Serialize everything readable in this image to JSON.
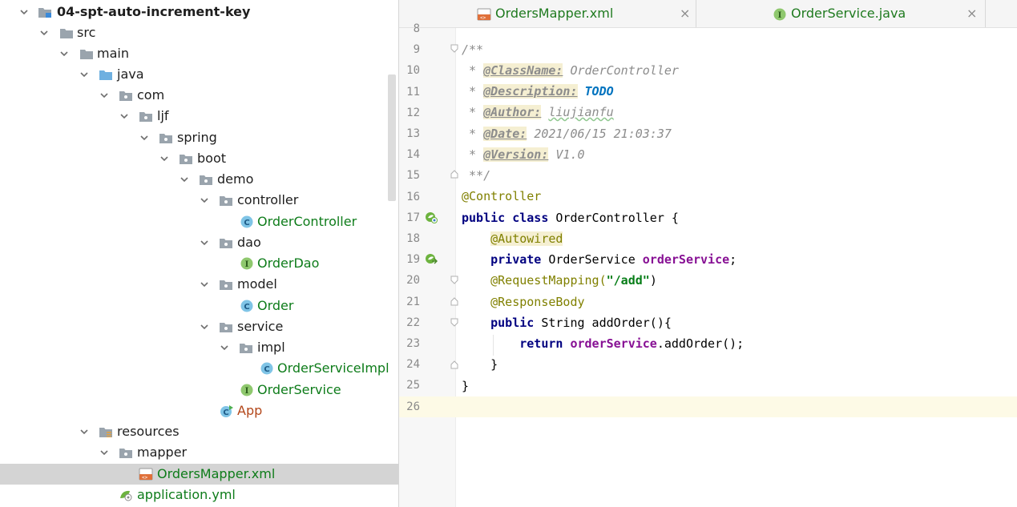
{
  "tree": {
    "items": [
      {
        "label": "04-spt-auto-increment-key",
        "icon": "module-folder-icon",
        "style": "bold"
      },
      {
        "label": "src",
        "icon": "folder-icon",
        "style": "normal"
      },
      {
        "label": "main",
        "icon": "folder-icon",
        "style": "normal"
      },
      {
        "label": "java",
        "icon": "source-root-folder-icon",
        "style": "normal"
      },
      {
        "label": "com",
        "icon": "package-icon",
        "style": "normal"
      },
      {
        "label": "ljf",
        "icon": "package-icon",
        "style": "normal"
      },
      {
        "label": "spring",
        "icon": "package-icon",
        "style": "normal"
      },
      {
        "label": "boot",
        "icon": "package-icon",
        "style": "normal"
      },
      {
        "label": "demo",
        "icon": "package-icon",
        "style": "normal"
      },
      {
        "label": "controller",
        "icon": "package-icon",
        "style": "normal"
      },
      {
        "label": "OrderController",
        "icon": "class-icon",
        "style": "green"
      },
      {
        "label": "dao",
        "icon": "package-icon",
        "style": "normal"
      },
      {
        "label": "OrderDao",
        "icon": "interface-icon",
        "style": "green"
      },
      {
        "label": "model",
        "icon": "package-icon",
        "style": "normal"
      },
      {
        "label": "Order",
        "icon": "class-icon",
        "style": "green"
      },
      {
        "label": "service",
        "icon": "package-icon",
        "style": "normal"
      },
      {
        "label": "impl",
        "icon": "package-icon",
        "style": "normal"
      },
      {
        "label": "OrderServiceImpl",
        "icon": "class-icon",
        "style": "green"
      },
      {
        "label": "OrderService",
        "icon": "interface-icon",
        "style": "green"
      },
      {
        "label": "App",
        "icon": "spring-boot-app-icon",
        "style": "red"
      },
      {
        "label": "resources",
        "icon": "resources-folder-icon",
        "style": "normal"
      },
      {
        "label": "mapper",
        "icon": "package-icon",
        "style": "normal"
      },
      {
        "label": "OrdersMapper.xml",
        "icon": "xml-file-icon",
        "style": "green",
        "selected": true
      },
      {
        "label": "application.yml",
        "icon": "yaml-config-icon",
        "style": "green"
      }
    ]
  },
  "tabs": [
    {
      "label": "OrdersMapper.xml",
      "icon": "xml-file-icon",
      "close": "×"
    },
    {
      "label": "OrderService.java",
      "icon": "interface-icon",
      "close": "×"
    }
  ],
  "editor": {
    "current_line": 26,
    "lines": [
      {
        "n": "8"
      },
      {
        "n": "9"
      },
      {
        "n": "10"
      },
      {
        "n": "11"
      },
      {
        "n": "12"
      },
      {
        "n": "13"
      },
      {
        "n": "14"
      },
      {
        "n": "15"
      },
      {
        "n": "16"
      },
      {
        "n": "17"
      },
      {
        "n": "18"
      },
      {
        "n": "19"
      },
      {
        "n": "20"
      },
      {
        "n": "21"
      },
      {
        "n": "22"
      },
      {
        "n": "23"
      },
      {
        "n": "24"
      },
      {
        "n": "25"
      },
      {
        "n": "26"
      }
    ],
    "code": {
      "l9": "/**",
      "l10_tag": "@ClassName:",
      "l10_val": "OrderController",
      "l11_tag": "@Description:",
      "l11_val": "TODO",
      "l12_tag": "@Author:",
      "l12_val": "liujianfu",
      "l13_tag": "@Date:",
      "l13_val": "2021/06/15 21:03:37",
      "l14_tag": "@Version:",
      "l14_val": "V1.0",
      "l15": "**/",
      "l16": "@Controller",
      "l17_kw1": "public",
      "l17_kw2": "class",
      "l17_rest": "OrderController {",
      "l18": "@Autowired",
      "l19_kw": "private",
      "l19_type": "OrderService",
      "l19_field": "orderService",
      "l19_end": ";",
      "l20_ann": "@RequestMapping(",
      "l20_str": "\"/add\"",
      "l20_end": ")",
      "l21": "@ResponseBody",
      "l22_kw": "public",
      "l22_rest": "String addOrder(){",
      "l23_kw": "return",
      "l23_field": "orderService",
      "l23_rest": ".addOrder();",
      "l24": "}",
      "l25": "}"
    }
  },
  "colors": {
    "keyword": "#000080",
    "annotation": "#808000",
    "string": "#067d17",
    "field": "#871094",
    "comment": "#8c8c8c",
    "todo": "#0073bf",
    "tree_green": "#0e7c1a",
    "tree_red": "#b3471a"
  }
}
